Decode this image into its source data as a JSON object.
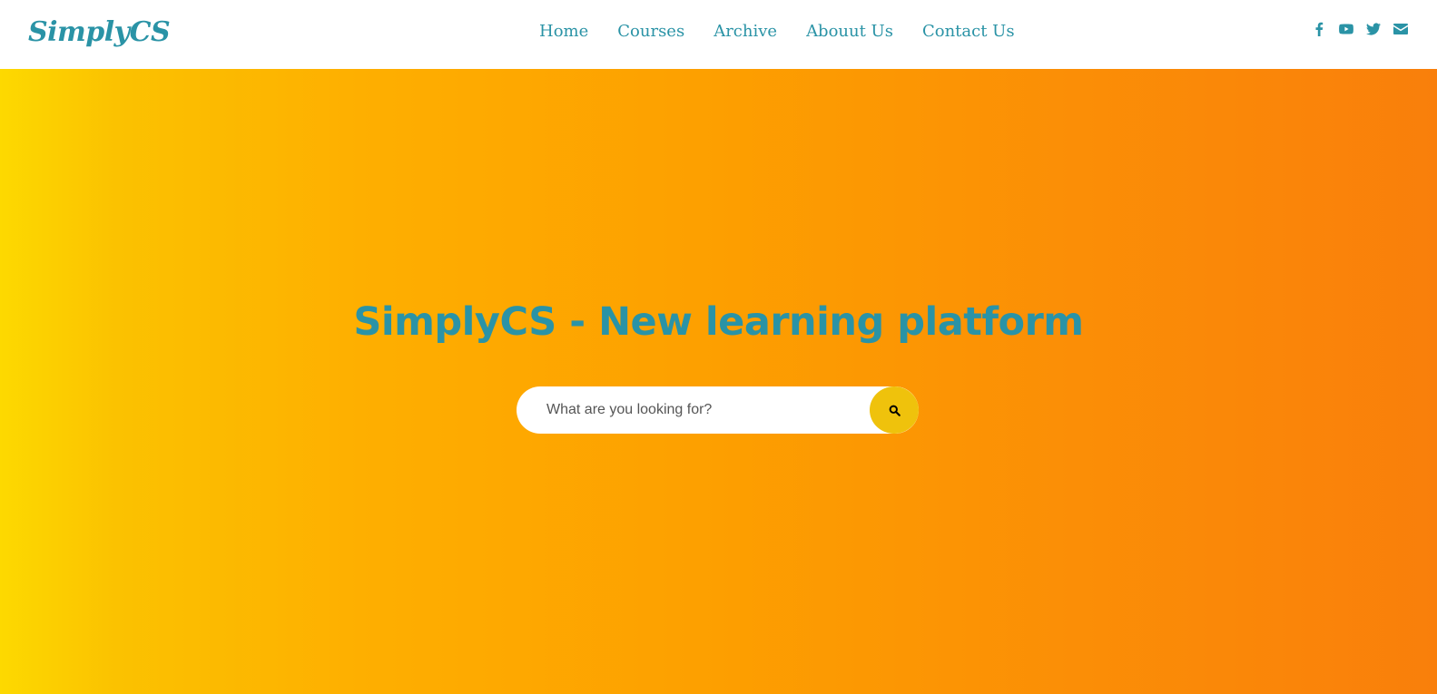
{
  "brand": {
    "logo_text": "SimplyCS"
  },
  "nav": {
    "items": [
      {
        "label": "Home"
      },
      {
        "label": "Courses"
      },
      {
        "label": "Archive"
      },
      {
        "label": "Abouut Us"
      },
      {
        "label": "Contact Us"
      }
    ]
  },
  "social": {
    "icons": [
      "facebook-icon",
      "youtube-icon",
      "twitter-icon",
      "envelope-icon"
    ]
  },
  "hero": {
    "title": "SimplyCS - New learning platform",
    "search": {
      "placeholder": "What are you looking for?",
      "value": ""
    }
  },
  "colors": {
    "accent": "#2a93a6",
    "search_button": "#efc20c",
    "gradient_start": "#fdd900",
    "gradient_end": "#f97f0b"
  }
}
